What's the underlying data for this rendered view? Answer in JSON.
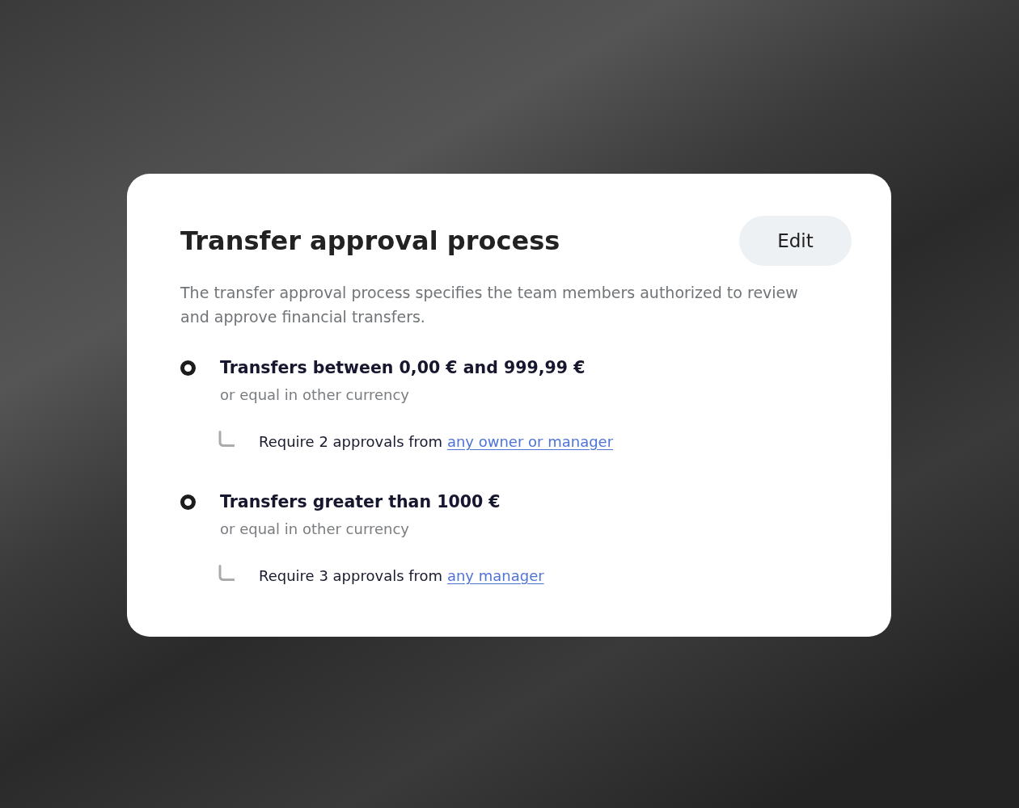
{
  "card": {
    "title": "Transfer approval process",
    "edit_button": "Edit",
    "description": "The transfer approval process specifies the team members authorized to review and approve financial transfers."
  },
  "rules": [
    {
      "title": "Transfers between 0,00 € and 999,99 €",
      "subtitle": "or equal in other currency",
      "requirement": "Require 2 approvals from",
      "link": "any owner or manager"
    },
    {
      "title": "Transfers greater than 1000 €",
      "subtitle": "or equal in other currency",
      "requirement": "Require 3 approvals from",
      "link": "any manager"
    }
  ]
}
